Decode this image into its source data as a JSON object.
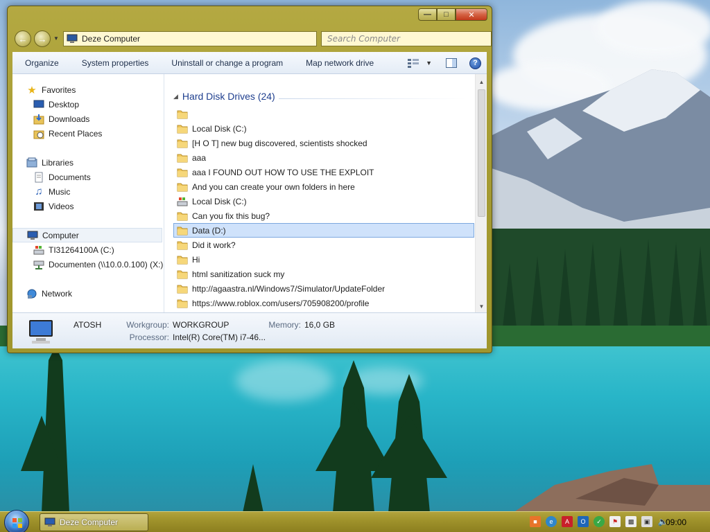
{
  "window": {
    "address": "Deze Computer",
    "search_placeholder": "Search Computer"
  },
  "toolbar": {
    "items": [
      "Organize",
      "System properties",
      "Uninstall or change a program",
      "Map network drive"
    ]
  },
  "nav": {
    "favorites": "Favorites",
    "desktop": "Desktop",
    "downloads": "Downloads",
    "recent": "Recent Places",
    "libraries": "Libraries",
    "documents": "Documents",
    "music": "Music",
    "videos": "Videos",
    "computer": "Computer",
    "drive_c": "TI31264100A (C:)",
    "drive_x": "Documenten (\\\\10.0.0.100) (X:)",
    "network": "Network"
  },
  "files": {
    "group_title": "Hard Disk Drives (24)",
    "items": [
      "",
      "Local Disk (C:)",
      "[H O T] new bug discovered, scientists shocked",
      "aaa",
      "aaa I FOUND OUT HOW TO USE THE EXPLOIT",
      "And you can create your own folders in here",
      "Local Disk (C:)",
      "Can you fix this bug?",
      "Data (D:)",
      "Did it work?",
      "Hi",
      "html sanitization suck my",
      "http://agaastra.nl/Windows7/Simulator/UpdateFolder",
      "https://www.roblox.com/users/705908200/profile"
    ]
  },
  "details": {
    "name": "ATOSH",
    "workgroup_label": "Workgroup:",
    "workgroup": "WORKGROUP",
    "memory_label": "Memory:",
    "memory": "16,0 GB",
    "processor_label": "Processor:",
    "processor": "Intel(R) Core(TM) i7-46..."
  },
  "taskbar": {
    "window_title": "Deze Computer",
    "clock": "09:00"
  },
  "colors": {
    "window_frame": "#a69c33",
    "selection": "#cfe2fb",
    "link_blue": "#1e3e8e"
  }
}
